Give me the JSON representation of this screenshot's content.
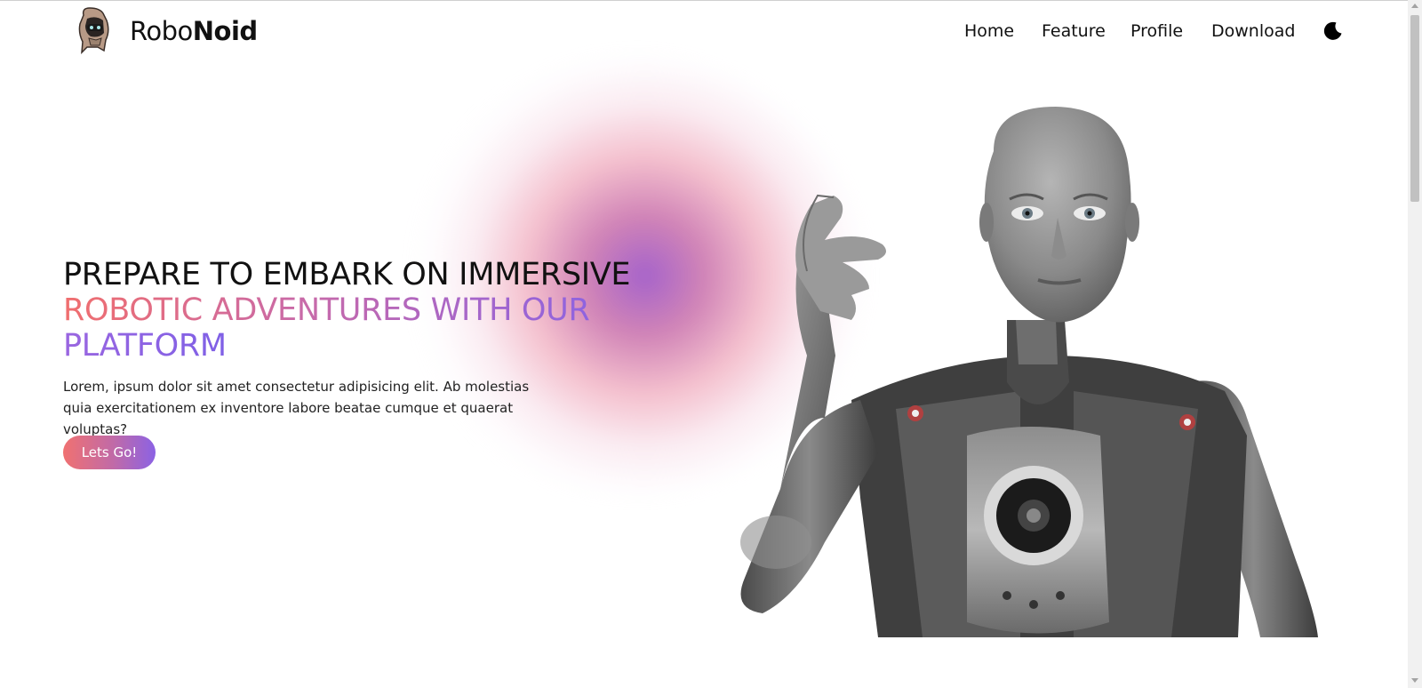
{
  "header": {
    "brand": {
      "light": "Robo",
      "bold": "Noid"
    },
    "nav": [
      {
        "label": "Home"
      },
      {
        "label": "Feature"
      },
      {
        "label": "Profile"
      },
      {
        "label": "Download"
      }
    ],
    "theme_icon": "moon-icon"
  },
  "hero": {
    "headline_line1": "PREPARE TO EMBARK ON IMMERSIVE",
    "headline_line2": "ROBOTIC ADVENTURES WITH OUR",
    "headline_line3": "PLATFORM",
    "description": "Lorem, ipsum dolor sit amet consectetur adipisicing elit. Ab molestias quia exercitationem ex inventore labore beatae cumque et quaerat voluptas?",
    "cta_label": "Lets Go!"
  },
  "colors": {
    "gradient_start": "#f07171",
    "gradient_mid": "#c06aa8",
    "gradient_end": "#8b62e4",
    "text": "#111111",
    "background": "#ffffff"
  },
  "images": {
    "logo": "hooded-robot-logo",
    "hero": "humanoid-robot-image"
  }
}
